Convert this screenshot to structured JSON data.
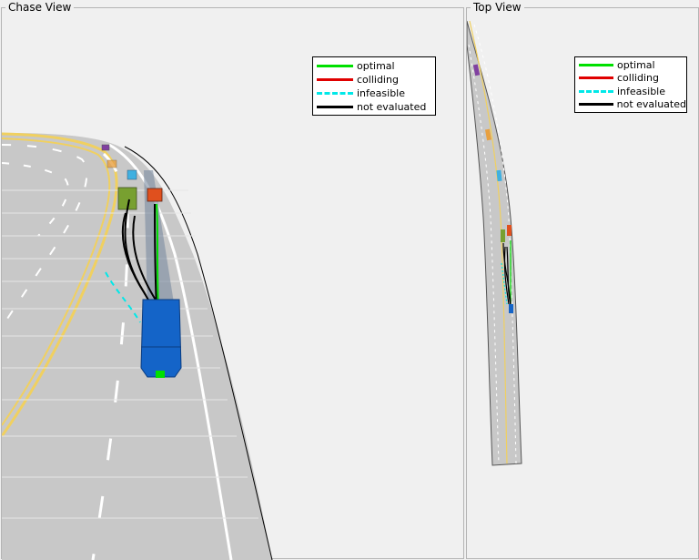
{
  "chase_view": {
    "title": "Chase View",
    "legend": [
      {
        "label": "optimal",
        "color": "#00e000",
        "style": "solid"
      },
      {
        "label": "colliding",
        "color": "#e00000",
        "style": "solid"
      },
      {
        "label": "infeasible",
        "color": "#00e8e8",
        "style": "dashed"
      },
      {
        "label": "not evaluated",
        "color": "#000000",
        "style": "solid"
      }
    ]
  },
  "top_view": {
    "title": "Top View",
    "legend": [
      {
        "label": "optimal",
        "color": "#00e000",
        "style": "solid"
      },
      {
        "label": "colliding",
        "color": "#e00000",
        "style": "solid"
      },
      {
        "label": "infeasible",
        "color": "#00e8e8",
        "style": "dashed"
      },
      {
        "label": "not evaluated",
        "color": "#000000",
        "style": "solid"
      }
    ]
  },
  "colors": {
    "road": "#c8c8c8",
    "lane_marking": "#ffffff",
    "center_line": "#f0d060",
    "ego_vehicle": "#1464c8",
    "lead_vehicle": "#e0501e",
    "green_vehicle": "#78a030",
    "orange_vehicle": "#e8a040",
    "cyan_vehicle": "#40b0e0",
    "purple_vehicle": "#8040a0"
  }
}
